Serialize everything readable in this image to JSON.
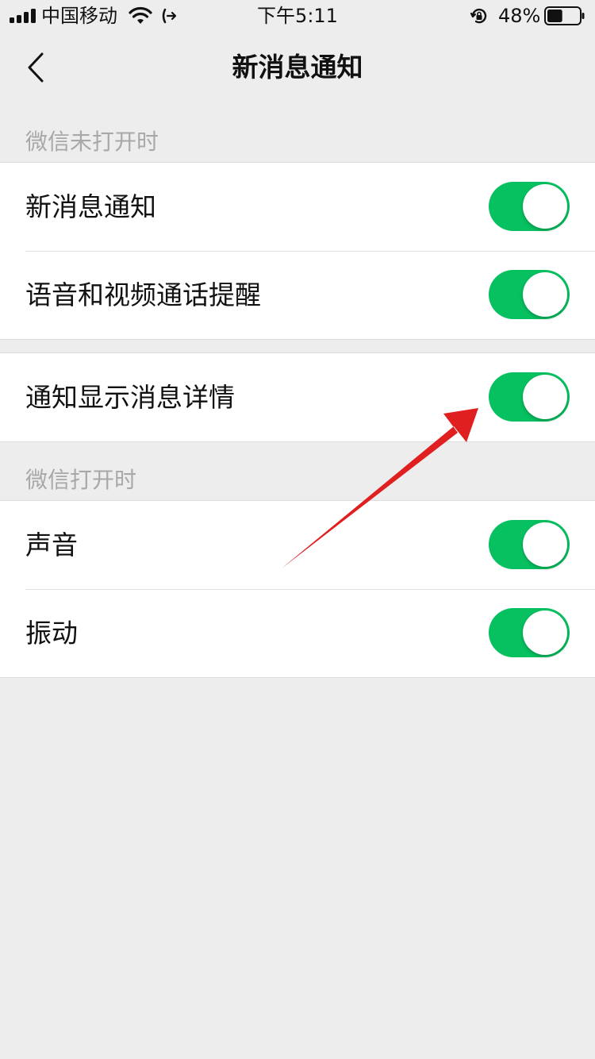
{
  "status_bar": {
    "carrier": "中国移动",
    "time": "下午5:11",
    "battery": "48%",
    "icons": [
      "signal-icon",
      "wifi-icon",
      "call-forward-icon",
      "rotation-lock-icon",
      "battery-icon"
    ],
    "battery_level": 0.48
  },
  "nav": {
    "title": "新消息通知",
    "back_icon": "chevron-left-icon"
  },
  "sections": {
    "closed_header": "微信未打开时",
    "open_header": "微信打开时"
  },
  "settings": {
    "new_message": {
      "label": "新消息通知",
      "on": true
    },
    "voice_video_reminder": {
      "label": "语音和视频通话提醒",
      "on": true
    },
    "show_details": {
      "label": "通知显示消息详情",
      "on": true
    },
    "sound": {
      "label": "声音",
      "on": true
    },
    "vibration": {
      "label": "振动",
      "on": true
    }
  },
  "colors": {
    "accent": "#07c160",
    "background": "#ededed",
    "annotation_arrow": "#e02020"
  }
}
